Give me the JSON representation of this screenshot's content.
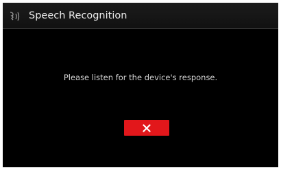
{
  "dialog": {
    "title": "Speech Recognition",
    "title_icon": "voice-recognition-icon",
    "message": "Please listen for the device's response.",
    "cancel_icon": "close-icon"
  },
  "colors": {
    "background": "#000000",
    "header_text": "#ececec",
    "message_text": "#d6d6d6",
    "accent_red": "#e2171b"
  }
}
